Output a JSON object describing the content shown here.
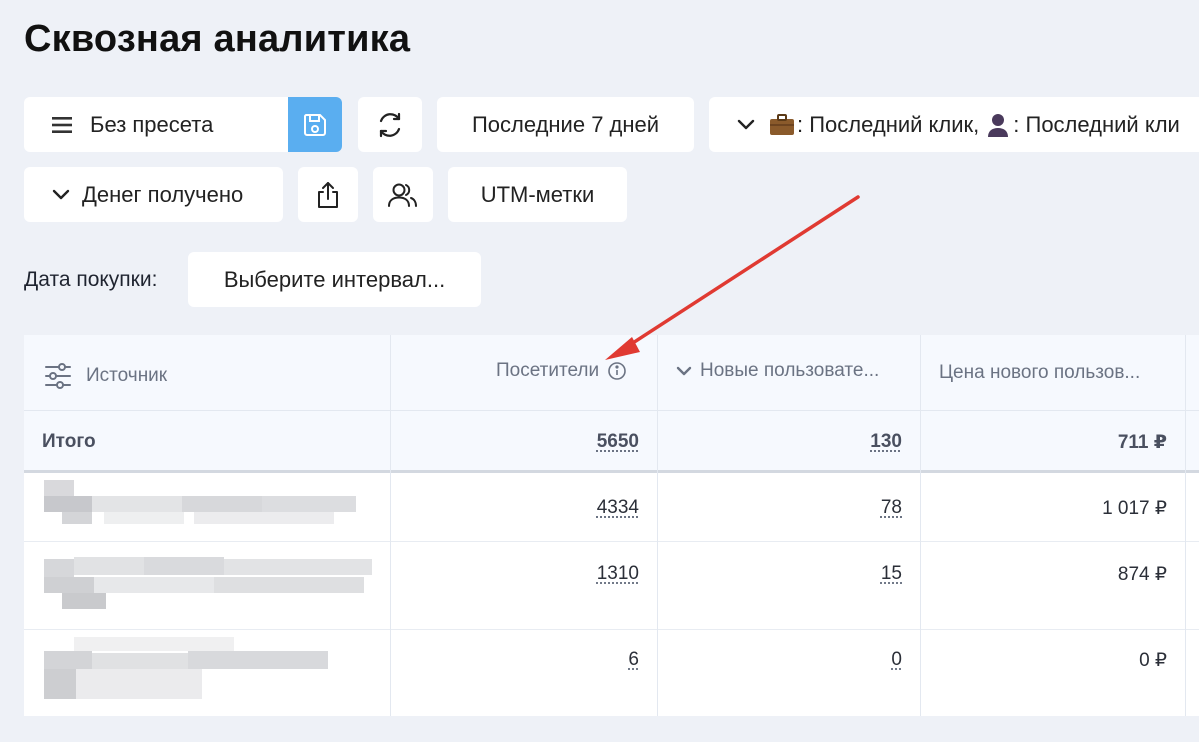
{
  "page": {
    "title": "Сквозная аналитика"
  },
  "toolbar": {
    "preset_label": "Без пресета",
    "period_label": "Последние 7 дней",
    "attribution_label": ": Последний клик,",
    "attribution_label2": ": Последний кли",
    "money_label": "Денег получено",
    "utm_label": "UTM-метки"
  },
  "filters": {
    "purchase_date_label": "Дата покупки:",
    "interval_placeholder": "Выберите интервал..."
  },
  "table": {
    "columns": [
      {
        "label": "Источник"
      },
      {
        "label": "Посетители"
      },
      {
        "label": "Новые пользовате..."
      },
      {
        "label": "Цена нового пользов..."
      }
    ],
    "total": {
      "label": "Итого",
      "visitors": "5650",
      "new_users": "130",
      "new_user_price": "711 ₽"
    },
    "rows": [
      {
        "visitors": "4334",
        "new_users": "78",
        "new_user_price": "1 017 ₽"
      },
      {
        "visitors": "1310",
        "new_users": "15",
        "new_user_price": "874 ₽"
      },
      {
        "visitors": "6",
        "new_users": "0",
        "new_user_price": "0 ₽"
      }
    ]
  },
  "colors": {
    "accent": "#5aaef0",
    "background": "#eef1f7",
    "annotation_arrow": "#e03a32"
  },
  "icons": [
    "menu-icon",
    "save-icon",
    "refresh-icon",
    "chevron-down-icon",
    "briefcase-icon",
    "user-icon",
    "export-icon",
    "users-icon",
    "settings-sliders-icon",
    "info-icon"
  ]
}
